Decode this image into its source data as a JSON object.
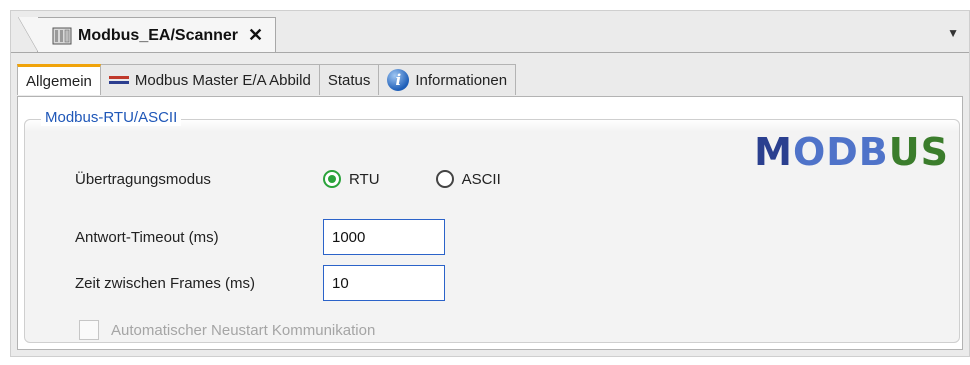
{
  "document_tab": {
    "title": "Modbus_EA/Scanner",
    "close_icon": "close-icon",
    "menu_icon": "dropdown-icon"
  },
  "tabs": [
    {
      "label": "Allgemein",
      "active": true
    },
    {
      "label": "Modbus Master E/A Abbild",
      "icon": "modbus-master-icon"
    },
    {
      "label": "Status"
    },
    {
      "label": "Informationen",
      "icon": "info-icon"
    }
  ],
  "group": {
    "title": "Modbus-RTU/ASCII",
    "logo": {
      "parts": [
        "M",
        "ODB",
        "US"
      ],
      "colors": [
        "#2a3f8f",
        "#4f73c9",
        "#3b7d2c"
      ]
    }
  },
  "settings": {
    "transmission_mode": {
      "label": "Übertragungsmodus",
      "options": [
        "RTU",
        "ASCII"
      ],
      "selected": "RTU",
      "accent": "#2aa33a"
    },
    "response_timeout": {
      "label": "Antwort-Timeout (ms)",
      "value": "1000"
    },
    "frame_gap": {
      "label": "Zeit zwischen Frames (ms)",
      "value": "10"
    },
    "auto_restart": {
      "label": "Automatischer Neustart Kommunikation",
      "checked": false,
      "disabled": true
    }
  }
}
